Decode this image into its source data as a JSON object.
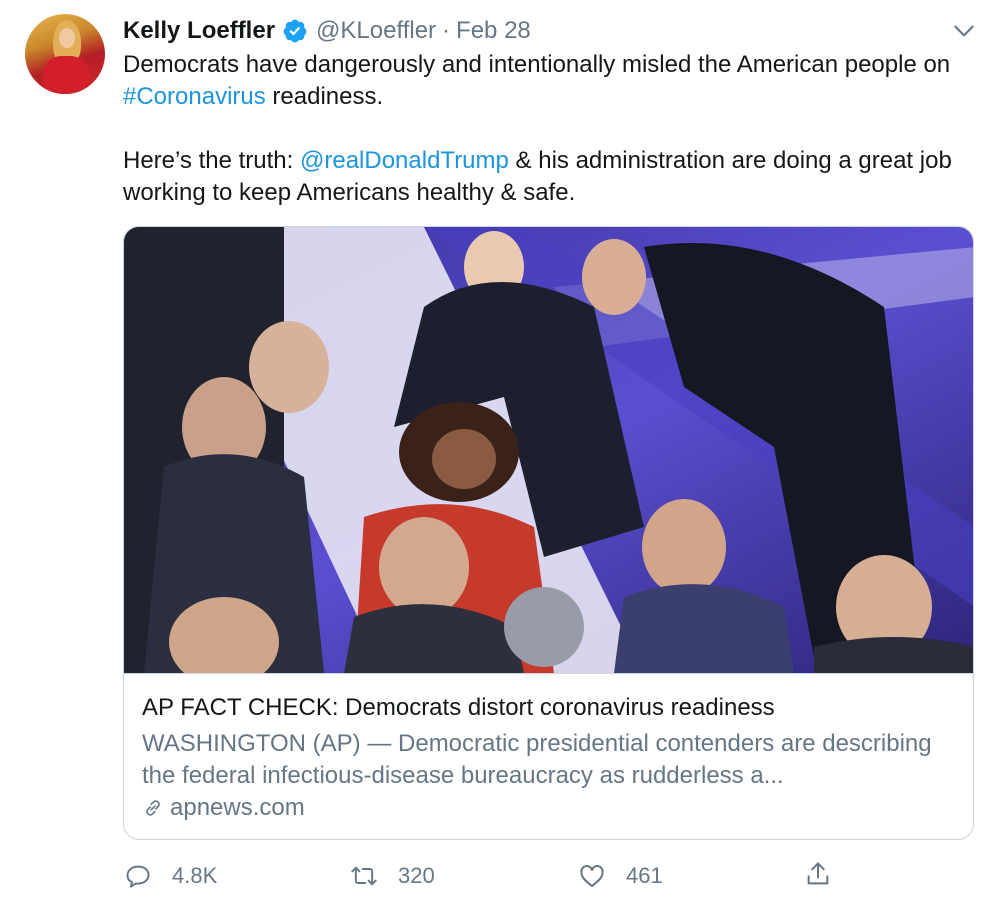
{
  "tweet": {
    "author": {
      "name": "Kelly Loeffler",
      "handle": "@KLoeffler",
      "separator": "·",
      "date": "Feb 28",
      "verified": true
    },
    "text": {
      "line1_pre": "Democrats have dangerously and intentionally misled the American people on ",
      "hashtag": "#Coronavirus",
      "line1_post": " readiness.",
      "line2_pre": "Here’s the truth: ",
      "mention": "@realDonaldTrump",
      "line2_post": " & his administration are doing a great job working to keep Americans healthy & safe."
    },
    "card": {
      "title": "AP FACT CHECK: Democrats distort coronavirus readiness",
      "description": "WASHINGTON (AP) — Democratic presidential contenders are describing the federal infectious-disease bureaucracy as rudderless a...",
      "domain": "apnews.com"
    },
    "actions": {
      "reply_count": "4.8K",
      "retweet_count": "320",
      "like_count": "461"
    }
  },
  "colors": {
    "link": "#1b95e0",
    "secondary_text": "#657786",
    "verified_badge": "#1da1f2",
    "border": "#ccd6dd"
  }
}
